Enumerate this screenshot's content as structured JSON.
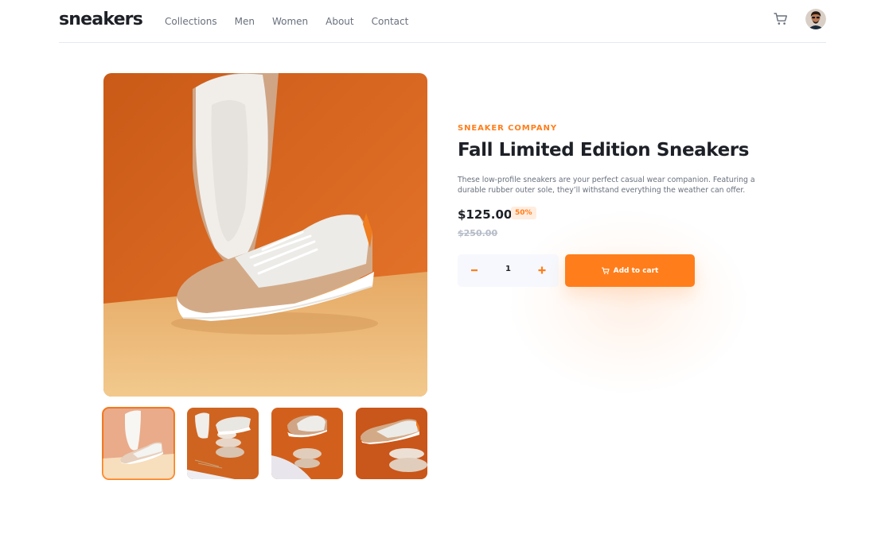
{
  "header": {
    "logo": "sneakers",
    "nav": [
      "Collections",
      "Men",
      "Women",
      "About",
      "Contact"
    ]
  },
  "product": {
    "company": "SNEAKER COMPANY",
    "title": "Fall Limited Edition Sneakers",
    "description": "These low-profile sneakers are your perfect casual wear companion. Featuring a durable rubber outer sole, they’ll withstand everything the weather can offer.",
    "price": "$125.00",
    "discount": "50%",
    "original_price": "$250.00",
    "quantity": "1",
    "add_to_cart_label": "Add to cart",
    "selected_thumbnail": 1
  },
  "colors": {
    "accent": "#ff7e1b",
    "pale_accent": "#ffede0",
    "dark": "#1d2026",
    "grey": "#69707d"
  },
  "icons": {
    "cart": "cart-icon",
    "minus": "minus-icon",
    "plus": "plus-icon"
  }
}
